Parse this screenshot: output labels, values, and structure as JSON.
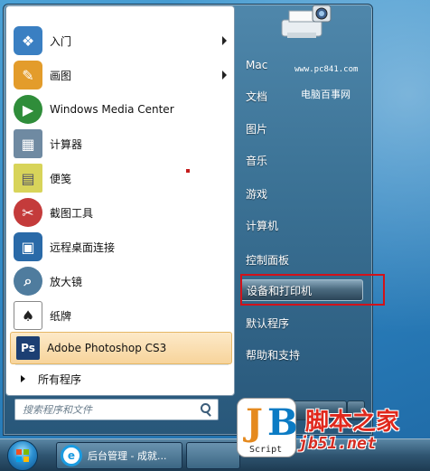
{
  "left_pane": {
    "items": [
      {
        "label": "入门",
        "icon": "getting-started-icon",
        "color": "#3a7fc2",
        "submenu": true
      },
      {
        "label": "画图",
        "icon": "paint-icon",
        "color": "#e39c2b",
        "submenu": true
      },
      {
        "label": "Windows Media Center",
        "icon": "media-center-icon",
        "color": "#2f8d3a",
        "submenu": false
      },
      {
        "label": "计算器",
        "icon": "calculator-icon",
        "color": "#6f8aa2",
        "submenu": false
      },
      {
        "label": "便笺",
        "icon": "sticky-notes-icon",
        "color": "#d8d45a",
        "submenu": false
      },
      {
        "label": "截图工具",
        "icon": "snipping-tool-icon",
        "color": "#c43b3b",
        "submenu": false
      },
      {
        "label": "远程桌面连接",
        "icon": "remote-desktop-icon",
        "color": "#2a6aa8",
        "submenu": false
      },
      {
        "label": "放大镜",
        "icon": "magnifier-icon",
        "color": "#4f7c9e",
        "submenu": false
      },
      {
        "label": "纸牌",
        "icon": "solitaire-icon",
        "color": "#6b6b6b",
        "submenu": false
      },
      {
        "label": "Adobe Photoshop CS3",
        "icon": "photoshop-icon",
        "color": "#1c3f73",
        "submenu": false
      }
    ],
    "all_programs": "所有程序",
    "search_placeholder": "搜索程序和文件"
  },
  "right_pane": {
    "items": [
      "Mac",
      "文档",
      "图片",
      "音乐",
      "游戏",
      "计算机",
      "控制面板",
      "设备和打印机",
      "默认程序",
      "帮助和支持"
    ],
    "highlighted": "设备和打印机"
  },
  "watermark": {
    "url": "www.pc841.com",
    "site_name": "电脑百事网"
  },
  "taskbar": {
    "button_label": "后台管理 - 成就..."
  },
  "logo": {
    "j": "J",
    "b": "B",
    "script": "Script",
    "site_cn": "脚本之家",
    "site_url": "jb51.net"
  }
}
